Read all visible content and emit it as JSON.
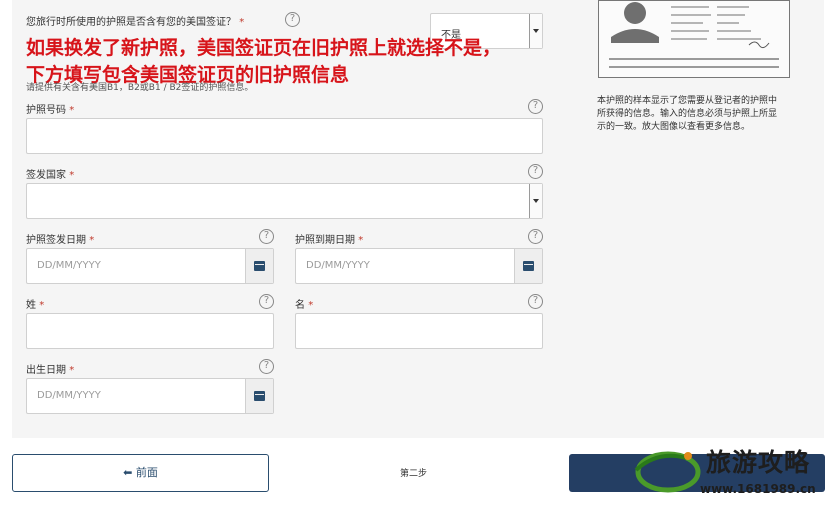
{
  "question": {
    "label": "您旅行时所使用的护照是否含有您的美国签证？",
    "required_mark": "*",
    "selected_value": "不是"
  },
  "annotation": {
    "line1": "如果换发了新护照，美国签证页在旧护照上就选择不是，",
    "line2": "下方填写包含美国签证页的旧护照信息"
  },
  "instruction": "请提供有关含有美国B1，B2或B1 / B2签证的护照信息。",
  "fields": {
    "passport_number": {
      "label": "护照号码",
      "required_mark": "*"
    },
    "issuing_country": {
      "label": "签发国家",
      "required_mark": "*"
    },
    "issue_date": {
      "label": "护照签发日期",
      "required_mark": "*",
      "placeholder": "DD/MM/YYYY"
    },
    "expiry_date": {
      "label": "护照到期日期",
      "required_mark": "*",
      "placeholder": "DD/MM/YYYY"
    },
    "surname": {
      "label": "姓",
      "required_mark": "*"
    },
    "given_name": {
      "label": "名",
      "required_mark": "*"
    },
    "birth_date": {
      "label": "出生日期",
      "required_mark": "*",
      "placeholder": "DD/MM/YYYY"
    }
  },
  "help_glyph": "?",
  "side_note": "本护照的样本显示了您需要从登记者的护照中所获得的信息。输入的信息必须与护照上所显示的一致。放大图像以查看更多信息。",
  "footer": {
    "prev_label": "⬅ 前面",
    "step_label": "第二步"
  },
  "watermark": {
    "text": "旅游攻略",
    "url": "www.1681989.cn"
  },
  "colors": {
    "accent": "#243e63",
    "required": "#c0392b",
    "annotation": "#d7141a"
  }
}
